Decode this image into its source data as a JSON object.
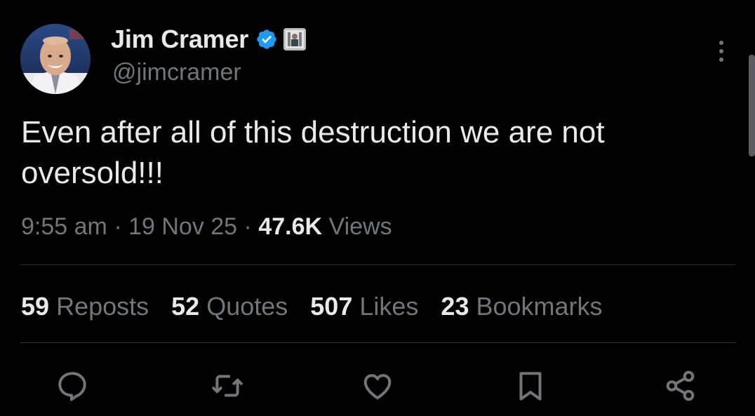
{
  "author": {
    "display_name": "Jim Cramer",
    "handle": "@jimcramer",
    "verified_icon": "verified-badge-icon",
    "affiliate_icon": "affiliate-badge-icon",
    "avatar_icon": "profile-avatar"
  },
  "post": {
    "text": "Even after all of this destruction we are not\noversold!!!",
    "time": "9:55 am",
    "separator": "·",
    "date": "19 Nov 25",
    "views_count": "47.6K",
    "views_label": "Views"
  },
  "stats": [
    {
      "count": "59",
      "label": "Reposts"
    },
    {
      "count": "52",
      "label": "Quotes"
    },
    {
      "count": "507",
      "label": "Likes"
    },
    {
      "count": "23",
      "label": "Bookmarks"
    }
  ],
  "actions": [
    {
      "name": "reply-icon"
    },
    {
      "name": "repost-icon"
    },
    {
      "name": "like-icon"
    },
    {
      "name": "bookmark-icon"
    },
    {
      "name": "share-icon"
    }
  ],
  "colors": {
    "background": "#000000",
    "primary_text": "#e7e9ea",
    "secondary_text": "#71767b",
    "verified_blue": "#1d9bf0",
    "divider": "#2f3336"
  }
}
